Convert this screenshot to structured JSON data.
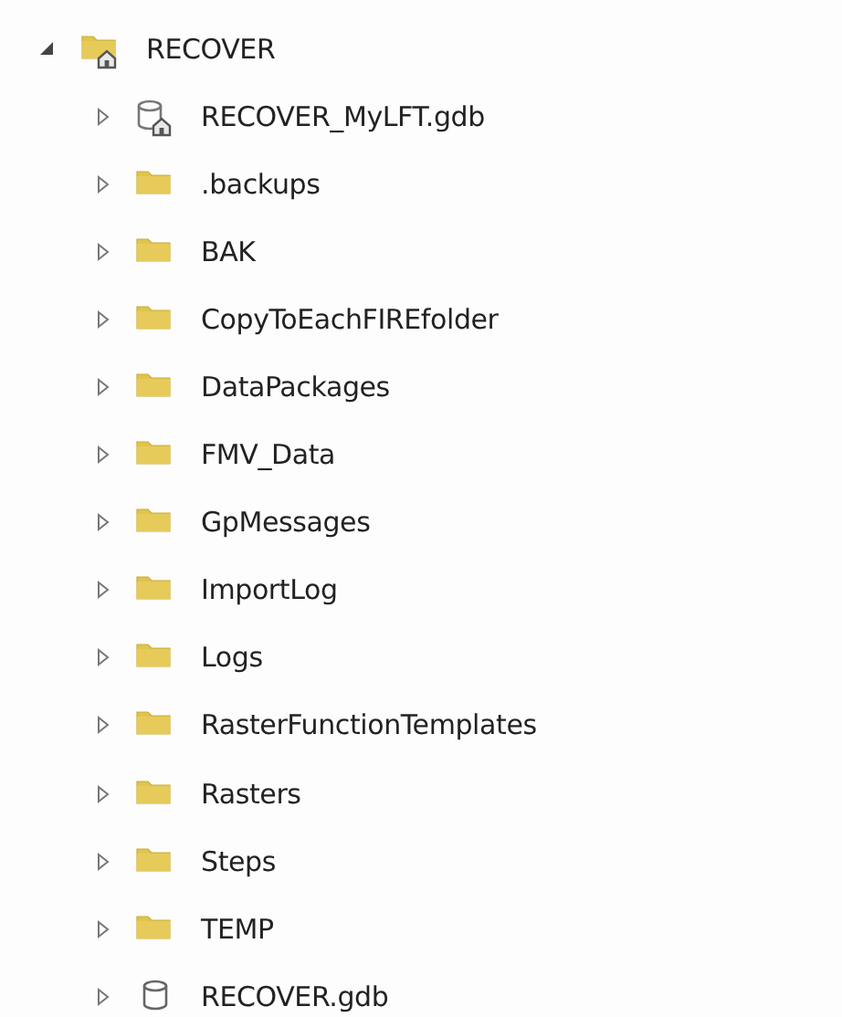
{
  "tree": {
    "label": "RECOVER",
    "kind": "home_folder",
    "expanded": true,
    "children": [
      {
        "label": "RECOVER_MyLFT.gdb",
        "kind": "home_gdb",
        "expanded": false
      },
      {
        "label": ".backups",
        "kind": "folder",
        "expanded": false
      },
      {
        "label": "BAK",
        "kind": "folder",
        "expanded": false
      },
      {
        "label": "CopyToEachFIREfolder",
        "kind": "folder",
        "expanded": false
      },
      {
        "label": "DataPackages",
        "kind": "folder",
        "expanded": false
      },
      {
        "label": "FMV_Data",
        "kind": "folder",
        "expanded": false
      },
      {
        "label": "GpMessages",
        "kind": "folder",
        "expanded": false
      },
      {
        "label": "ImportLog",
        "kind": "folder",
        "expanded": false
      },
      {
        "label": "Logs",
        "kind": "folder",
        "expanded": false
      },
      {
        "label": "RasterFunctionTemplates",
        "kind": "folder",
        "expanded": false
      },
      {
        "label": "Rasters",
        "kind": "folder",
        "expanded": false
      },
      {
        "label": "Steps",
        "kind": "folder",
        "expanded": false
      },
      {
        "label": "TEMP",
        "kind": "folder",
        "expanded": false
      },
      {
        "label": "RECOVER.gdb",
        "kind": "gdb",
        "expanded": false
      }
    ]
  }
}
